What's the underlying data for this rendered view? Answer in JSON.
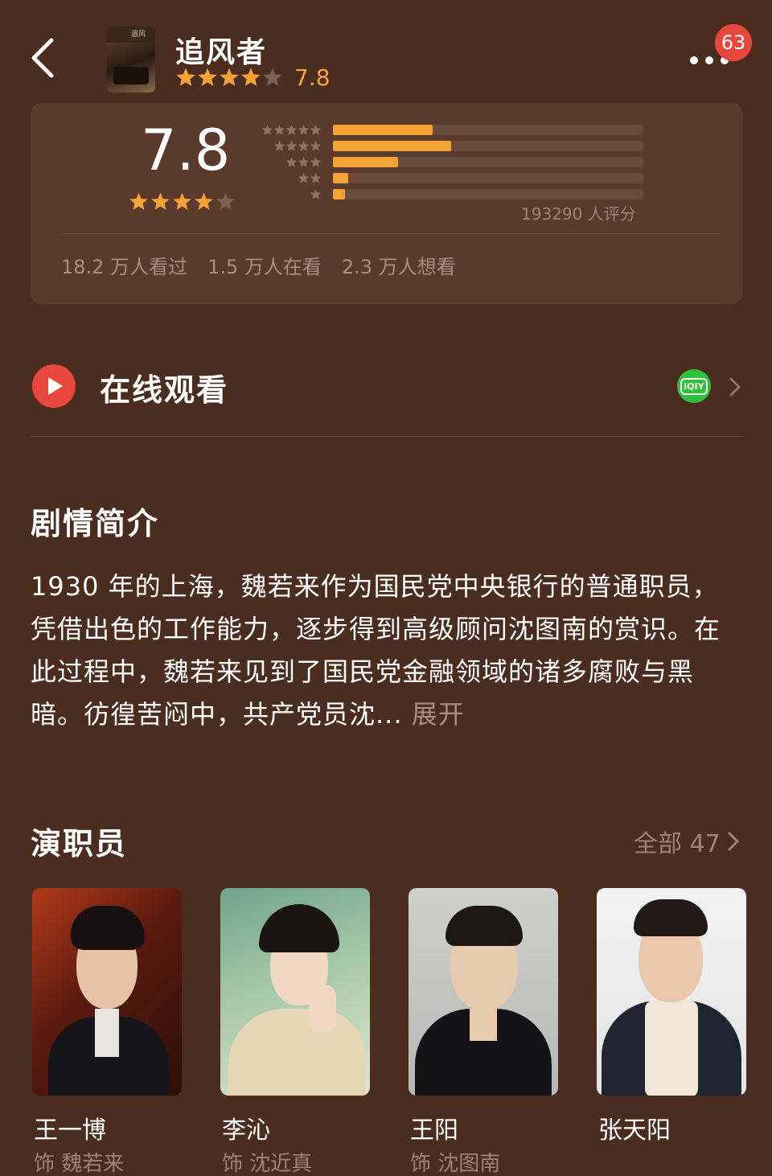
{
  "header": {
    "title": "追风者",
    "score": "7.8",
    "notification_count": "63",
    "poster_text": "追风"
  },
  "rating": {
    "score": "7.8",
    "stars_out_of_5": 4,
    "distribution_percent": [
      32,
      38,
      21,
      5,
      4
    ],
    "rating_count": "193290 人评分",
    "stats": [
      "18.2 万人看过",
      "1.5 万人在看",
      "2.3 万人想看"
    ]
  },
  "watch": {
    "label": "在线观看",
    "platform_label": "iQIY"
  },
  "synopsis": {
    "title": "剧情简介",
    "text": "1930 年的上海，魏若来作为国民党中央银行的普通职员，凭借出色的工作能力，逐步得到高级顾问沈图南的赏识。在此过程中，魏若来见到了国民党金融领域的诸多腐败与黑暗。彷徨苦闷中，共产党员沈...",
    "expand_label": "展开"
  },
  "cast": {
    "title": "演职员",
    "all_label": "全部 47",
    "members": [
      {
        "name": "王一博",
        "role": "饰 魏若来"
      },
      {
        "name": "李沁",
        "role": "饰 沈近真"
      },
      {
        "name": "王阳",
        "role": "饰 沈图南"
      },
      {
        "name": "张天阳",
        "role": ""
      }
    ]
  },
  "colors": {
    "background": "#4b2d20",
    "card": "#593a2b",
    "accent_orange": "#f4a234",
    "red": "#e8473e",
    "iqiyi_green": "#2fbf3b",
    "muted_text": "#9c8575"
  },
  "icons": [
    "chevron-left-icon",
    "more-dots-icon",
    "star-icon",
    "play-icon",
    "iqiyi-icon",
    "chevron-right-icon"
  ]
}
